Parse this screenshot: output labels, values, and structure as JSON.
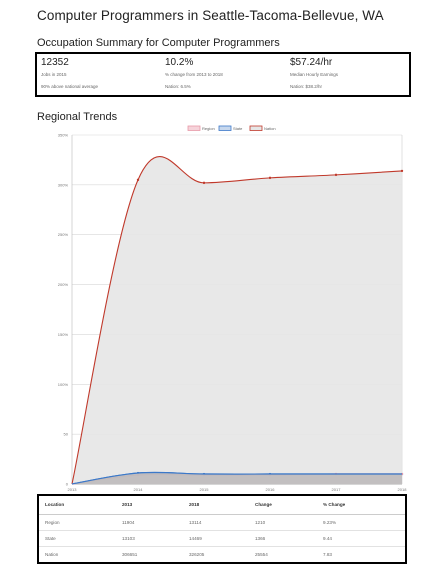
{
  "page": {
    "title": "Computer Programmers in Seattle-Tacoma-Bellevue, WA"
  },
  "summary": {
    "heading": "Occupation Summary for Computer Programmers",
    "jobs": {
      "value": "12352",
      "label": "Jobs in 2015",
      "note": "90% above national average"
    },
    "change": {
      "value": "10.2%",
      "label": "% change from 2013 to 2018",
      "note": "Nation: 6.5%"
    },
    "earnings": {
      "value": "$57.24/hr",
      "label": "Median Hourly Earnings",
      "note": "Nation: $38.2/hr"
    }
  },
  "trends": {
    "heading": "Regional Trends"
  },
  "chart_data": {
    "type": "area",
    "x": [
      2013,
      2014,
      2015,
      2016,
      2017,
      2018
    ],
    "x_tick_labels": [
      "2013",
      "2014",
      "2015",
      "2016",
      "2017",
      "2018"
    ],
    "y_tick_labels": [
      "0",
      "50",
      "100%",
      "150%",
      "200%",
      "250%",
      "300%",
      "350%"
    ],
    "ylim": [
      0,
      350
    ],
    "series": [
      {
        "name": "Region",
        "color": "#e89aa8",
        "fill": "#f6d3da",
        "values": [
          0,
          9,
          9,
          9,
          10,
          10
        ]
      },
      {
        "name": "State",
        "color": "#3c78c8",
        "fill": "#c7d8ee",
        "values": [
          0,
          11,
          10,
          10,
          10,
          10
        ]
      },
      {
        "name": "Nation",
        "color": "#c0392b",
        "fill": "#e6e6e6",
        "values": [
          0,
          305,
          302,
          307,
          310,
          314
        ]
      }
    ],
    "legend_position": "top-center",
    "grid": true
  },
  "table": {
    "headers": [
      "Location",
      "2013",
      "2018",
      "Change",
      "% Change"
    ],
    "rows": [
      [
        "Region",
        "11904",
        "13114",
        "1210",
        "9.23%"
      ],
      [
        "State",
        "13103",
        "14469",
        "1366",
        "9.44"
      ],
      [
        "Nation",
        "306651",
        "326205",
        "25554",
        "7.83"
      ]
    ]
  }
}
